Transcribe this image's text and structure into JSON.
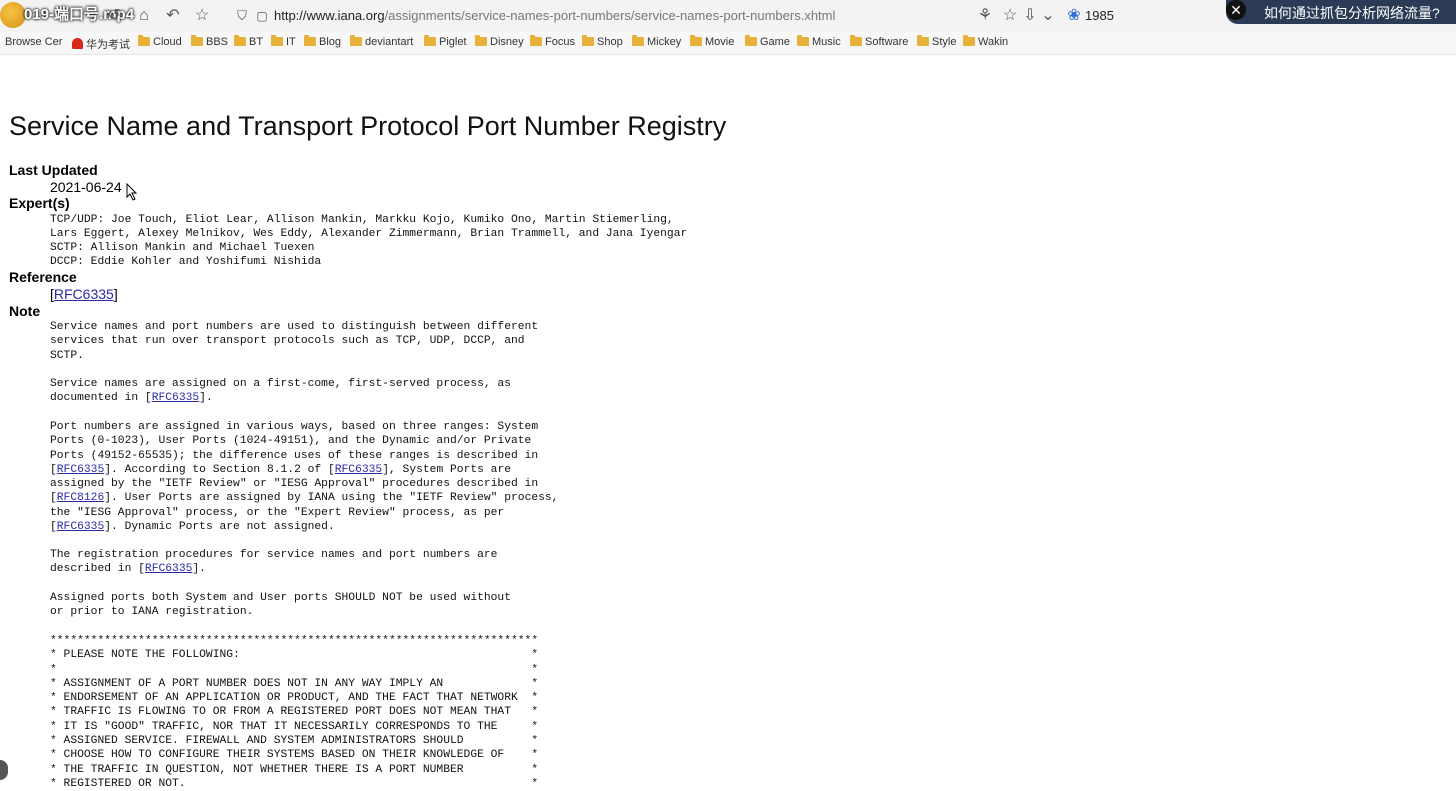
{
  "video_title": "019-端口号.mp4",
  "browser": {
    "url_host": "http://www.iana.org",
    "url_path": "/assignments/service-names-port-numbers/service-names-port-numbers.xhtml",
    "counter": "1985",
    "popup_text": "如何通过抓包分析网络流量?",
    "popup_close": "✕"
  },
  "bookmarks": {
    "browse": "Browse Cer",
    "huawei": "华为考试",
    "folders": [
      "Cloud",
      "BBS",
      "BT",
      "IT",
      "Blog",
      "deviantart",
      "Piglet",
      "Disney",
      "Focus",
      "Shop",
      "Mickey",
      "Movie",
      "Game",
      "Music",
      "Software",
      "Style",
      "Wakin"
    ]
  },
  "page": {
    "title": "Service Name and Transport Protocol Port Number Registry",
    "last_updated_label": "Last Updated",
    "last_updated_value": "2021-06-24",
    "experts_label": "Expert(s)",
    "experts_lines": [
      "TCP/UDP: Joe Touch, Eliot Lear, Allison Mankin, Markku Kojo, Kumiko Ono, Martin Stiemerling,",
      "Lars Eggert, Alexey Melnikov, Wes Eddy, Alexander Zimmermann, Brian Trammell, and Jana Iyengar",
      "SCTP: Allison Mankin and Michael Tuexen",
      "DCCP: Eddie Kohler and Yoshifumi Nishida"
    ],
    "reference_label": "Reference",
    "reference_link": "RFC6335",
    "note_label": "Note",
    "rfc6335": "RFC6335",
    "rfc8126": "RFC8126",
    "p1": "Service names and port numbers are used to distinguish between different\nservices that run over transport protocols such as TCP, UDP, DCCP, and\nSCTP.",
    "p2a": "Service names are assigned on a first-come, first-served process, as\ndocumented in [",
    "p2b": "].",
    "p3a": "Port numbers are assigned in various ways, based on three ranges: System\nPorts (0-1023), User Ports (1024-49151), and the Dynamic and/or Private\nPorts (49152-65535); the difference uses of these ranges is described in\n[",
    "p3b": "]. According to Section 8.1.2 of [",
    "p3c": "], System Ports are\nassigned by the \"IETF Review\" or \"IESG Approval\" procedures described in\n[",
    "p3d": "]. User Ports are assigned by IANA using the \"IETF Review\" process,\nthe \"IESG Approval\" process, or the \"Expert Review\" process, as per\n[",
    "p3e": "]. Dynamic Ports are not assigned.",
    "p4a": "The registration procedures for service names and port numbers are\ndescribed in [",
    "p4b": "].",
    "p5": "Assigned ports both System and User ports SHOULD NOT be used without\nor prior to IANA registration.",
    "notice": "************************************************************************\n* PLEASE NOTE THE FOLLOWING:                                           *\n*                                                                      *\n* ASSIGNMENT OF A PORT NUMBER DOES NOT IN ANY WAY IMPLY AN             *\n* ENDORSEMENT OF AN APPLICATION OR PRODUCT, AND THE FACT THAT NETWORK  *\n* TRAFFIC IS FLOWING TO OR FROM A REGISTERED PORT DOES NOT MEAN THAT   *\n* IT IS \"GOOD\" TRAFFIC, NOR THAT IT NECESSARILY CORRESPONDS TO THE     *\n* ASSIGNED SERVICE. FIREWALL AND SYSTEM ADMINISTRATORS SHOULD          *\n* CHOOSE HOW TO CONFIGURE THEIR SYSTEMS BASED ON THEIR KNOWLEDGE OF    *\n* THE TRAFFIC IN QUESTION, NOT WHETHER THERE IS A PORT NUMBER          *\n* REGISTERED OR NOT.                                                   *"
  },
  "icons": {
    "back": "↺",
    "home": "⌂",
    "undo": "↶",
    "star": "☆",
    "shield": "⛉",
    "lock": "▢",
    "share": "⚘",
    "fav": "☆",
    "download": "⇩",
    "chevron": "⌄",
    "paw": "❀"
  },
  "colors": {
    "link": "#2a2aa8",
    "popup_bg": "#2b3a55",
    "folder": "#e8b23a"
  }
}
